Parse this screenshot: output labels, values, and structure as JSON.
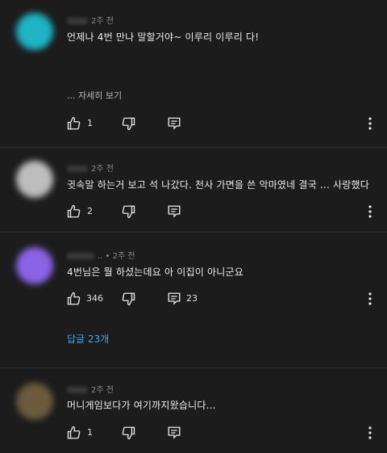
{
  "comments": [
    {
      "time": "2주 전",
      "text": "언제나 4번 만나 말할거야~ 이루리 이루리 다!",
      "more_label": "... 자세히 보기",
      "likes": "1",
      "avatar_color": "#1fb3c4"
    },
    {
      "time": "2주 전",
      "text": "귓속말 하는거 보고 석 나갔다. 천사 가면을 쓴 악마였네 결국 ... 사랑했다",
      "likes": "2",
      "avatar_color": "#bdbdbd"
    },
    {
      "name_fragment": "..",
      "time": "2주 전",
      "text": "4번님은 뭘 하셨는데요  아 이집이 아니군요",
      "likes": "346",
      "reply_count": "23",
      "replies_label": "답글 23개",
      "avatar_color": "#8a63e6"
    },
    {
      "time": "2주 전",
      "text": "머니게임보다가 여기까지왔습니다...",
      "likes": "1",
      "avatar_color": "#6b5a3e"
    }
  ],
  "colors": {
    "background": "#1c1c1c",
    "link": "#3ea6ff",
    "muted": "#8a8a8a"
  },
  "icons": [
    "like-icon",
    "dislike-icon",
    "reply-icon",
    "more-vert-icon"
  ]
}
